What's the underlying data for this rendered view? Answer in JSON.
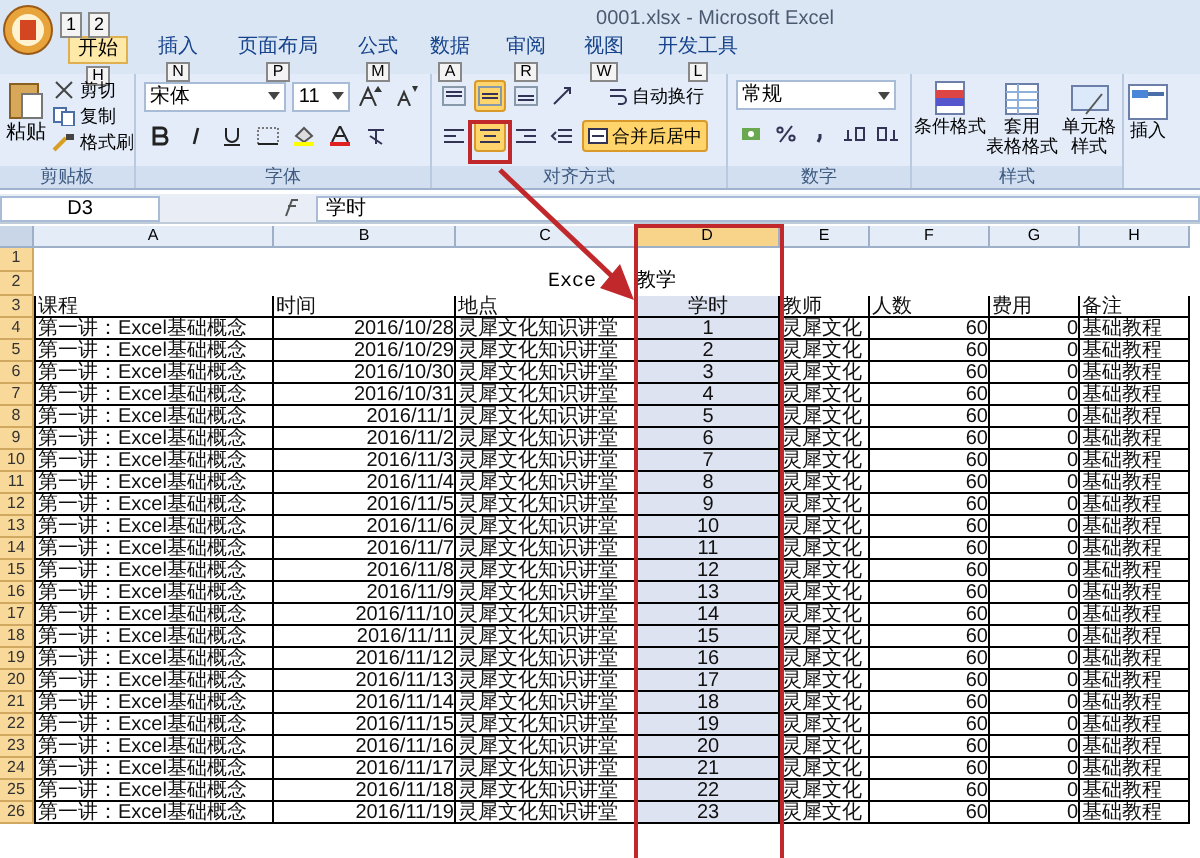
{
  "window": {
    "title": "0001.xlsx - Microsoft Excel",
    "quick_access": [
      {
        "keytip": "1"
      },
      {
        "keytip": "2"
      }
    ]
  },
  "tabs": [
    {
      "label": "开始",
      "keytip": "H",
      "selected": true
    },
    {
      "label": "插入",
      "keytip": "N",
      "selected": false
    },
    {
      "label": "页面布局",
      "keytip": "P",
      "selected": false
    },
    {
      "label": "公式",
      "keytip": "M",
      "selected": false
    },
    {
      "label": "数据",
      "keytip": "A",
      "selected": false
    },
    {
      "label": "审阅",
      "keytip": "R",
      "selected": false
    },
    {
      "label": "视图",
      "keytip": "W",
      "selected": false
    },
    {
      "label": "开发工具",
      "keytip": "L",
      "selected": false
    }
  ],
  "ribbon": {
    "clipboard": {
      "label": "剪贴板",
      "paste": "粘贴",
      "actions": [
        "剪切",
        "复制",
        "格式刷"
      ]
    },
    "font": {
      "label": "字体",
      "font_name": "宋体",
      "font_size": "11"
    },
    "alignment": {
      "label": "对齐方式",
      "vertical_align": [
        {
          "selected": false
        },
        {
          "selected": true
        },
        {
          "selected": false
        }
      ],
      "horizontal_align": [
        {
          "selected": false
        },
        {
          "selected": true
        },
        {
          "selected": false
        }
      ],
      "wrap_text": {
        "label": "自动换行",
        "selected": false
      },
      "merge_center": {
        "label": "合并后居中",
        "selected": true
      }
    },
    "number": {
      "label": "数字",
      "format": "常规"
    },
    "styles": {
      "label": "样式",
      "buttons": [
        {
          "lines": [
            "条件格式"
          ]
        },
        {
          "lines": [
            "套用",
            "表格格式"
          ]
        },
        {
          "lines": [
            "单元格",
            "样式"
          ]
        }
      ]
    },
    "cells": {
      "buttons": [
        {
          "label": "插入"
        }
      ]
    }
  },
  "formula_bar": {
    "name_box": "D3",
    "formula": "学时"
  },
  "columns": [
    {
      "label": "A",
      "selected": false
    },
    {
      "label": "B",
      "selected": false
    },
    {
      "label": "C",
      "selected": false
    },
    {
      "label": "D",
      "selected": true
    },
    {
      "label": "E",
      "selected": false
    },
    {
      "label": "F",
      "selected": false
    },
    {
      "label": "G",
      "selected": false
    },
    {
      "label": "H",
      "selected": false
    }
  ],
  "title_rows": [
    "1",
    "2"
  ],
  "title_cell": [
    "Exce",
    "教学"
  ],
  "header_row": {
    "row": "3",
    "cells": [
      "课程",
      "时间",
      "地点",
      "学时",
      "教师",
      "人数",
      "费用",
      "备注"
    ]
  },
  "rows": [
    {
      "row": "4",
      "cells": [
        "第一讲：Excel基础概念",
        "2016/10/28",
        "灵犀文化知识讲堂",
        "1",
        "灵犀文化",
        "60",
        "0",
        "基础教程"
      ]
    },
    {
      "row": "5",
      "cells": [
        "第一讲：Excel基础概念",
        "2016/10/29",
        "灵犀文化知识讲堂",
        "2",
        "灵犀文化",
        "60",
        "0",
        "基础教程"
      ]
    },
    {
      "row": "6",
      "cells": [
        "第一讲：Excel基础概念",
        "2016/10/30",
        "灵犀文化知识讲堂",
        "3",
        "灵犀文化",
        "60",
        "0",
        "基础教程"
      ]
    },
    {
      "row": "7",
      "cells": [
        "第一讲：Excel基础概念",
        "2016/10/31",
        "灵犀文化知识讲堂",
        "4",
        "灵犀文化",
        "60",
        "0",
        "基础教程"
      ]
    },
    {
      "row": "8",
      "cells": [
        "第一讲：Excel基础概念",
        "2016/11/1",
        "灵犀文化知识讲堂",
        "5",
        "灵犀文化",
        "60",
        "0",
        "基础教程"
      ]
    },
    {
      "row": "9",
      "cells": [
        "第一讲：Excel基础概念",
        "2016/11/2",
        "灵犀文化知识讲堂",
        "6",
        "灵犀文化",
        "60",
        "0",
        "基础教程"
      ]
    },
    {
      "row": "10",
      "cells": [
        "第一讲：Excel基础概念",
        "2016/11/3",
        "灵犀文化知识讲堂",
        "7",
        "灵犀文化",
        "60",
        "0",
        "基础教程"
      ]
    },
    {
      "row": "11",
      "cells": [
        "第一讲：Excel基础概念",
        "2016/11/4",
        "灵犀文化知识讲堂",
        "8",
        "灵犀文化",
        "60",
        "0",
        "基础教程"
      ]
    },
    {
      "row": "12",
      "cells": [
        "第一讲：Excel基础概念",
        "2016/11/5",
        "灵犀文化知识讲堂",
        "9",
        "灵犀文化",
        "60",
        "0",
        "基础教程"
      ]
    },
    {
      "row": "13",
      "cells": [
        "第一讲：Excel基础概念",
        "2016/11/6",
        "灵犀文化知识讲堂",
        "10",
        "灵犀文化",
        "60",
        "0",
        "基础教程"
      ]
    },
    {
      "row": "14",
      "cells": [
        "第一讲：Excel基础概念",
        "2016/11/7",
        "灵犀文化知识讲堂",
        "11",
        "灵犀文化",
        "60",
        "0",
        "基础教程"
      ]
    },
    {
      "row": "15",
      "cells": [
        "第一讲：Excel基础概念",
        "2016/11/8",
        "灵犀文化知识讲堂",
        "12",
        "灵犀文化",
        "60",
        "0",
        "基础教程"
      ]
    },
    {
      "row": "16",
      "cells": [
        "第一讲：Excel基础概念",
        "2016/11/9",
        "灵犀文化知识讲堂",
        "13",
        "灵犀文化",
        "60",
        "0",
        "基础教程"
      ]
    },
    {
      "row": "17",
      "cells": [
        "第一讲：Excel基础概念",
        "2016/11/10",
        "灵犀文化知识讲堂",
        "14",
        "灵犀文化",
        "60",
        "0",
        "基础教程"
      ]
    },
    {
      "row": "18",
      "cells": [
        "第一讲：Excel基础概念",
        "2016/11/11",
        "灵犀文化知识讲堂",
        "15",
        "灵犀文化",
        "60",
        "0",
        "基础教程"
      ]
    },
    {
      "row": "19",
      "cells": [
        "第一讲：Excel基础概念",
        "2016/11/12",
        "灵犀文化知识讲堂",
        "16",
        "灵犀文化",
        "60",
        "0",
        "基础教程"
      ]
    },
    {
      "row": "20",
      "cells": [
        "第一讲：Excel基础概念",
        "2016/11/13",
        "灵犀文化知识讲堂",
        "17",
        "灵犀文化",
        "60",
        "0",
        "基础教程"
      ]
    },
    {
      "row": "21",
      "cells": [
        "第一讲：Excel基础概念",
        "2016/11/14",
        "灵犀文化知识讲堂",
        "18",
        "灵犀文化",
        "60",
        "0",
        "基础教程"
      ]
    },
    {
      "row": "22",
      "cells": [
        "第一讲：Excel基础概念",
        "2016/11/15",
        "灵犀文化知识讲堂",
        "19",
        "灵犀文化",
        "60",
        "0",
        "基础教程"
      ]
    },
    {
      "row": "23",
      "cells": [
        "第一讲：Excel基础概念",
        "2016/11/16",
        "灵犀文化知识讲堂",
        "20",
        "灵犀文化",
        "60",
        "0",
        "基础教程"
      ]
    },
    {
      "row": "24",
      "cells": [
        "第一讲：Excel基础概念",
        "2016/11/17",
        "灵犀文化知识讲堂",
        "21",
        "灵犀文化",
        "60",
        "0",
        "基础教程"
      ]
    },
    {
      "row": "25",
      "cells": [
        "第一讲：Excel基础概念",
        "2016/11/18",
        "灵犀文化知识讲堂",
        "22",
        "灵犀文化",
        "60",
        "0",
        "基础教程"
      ]
    },
    {
      "row": "26",
      "cells": [
        "第一讲：Excel基础概念",
        "2016/11/19",
        "灵犀文化知识讲堂",
        "23",
        "灵犀文化",
        "60",
        "0",
        "基础教程"
      ]
    }
  ]
}
